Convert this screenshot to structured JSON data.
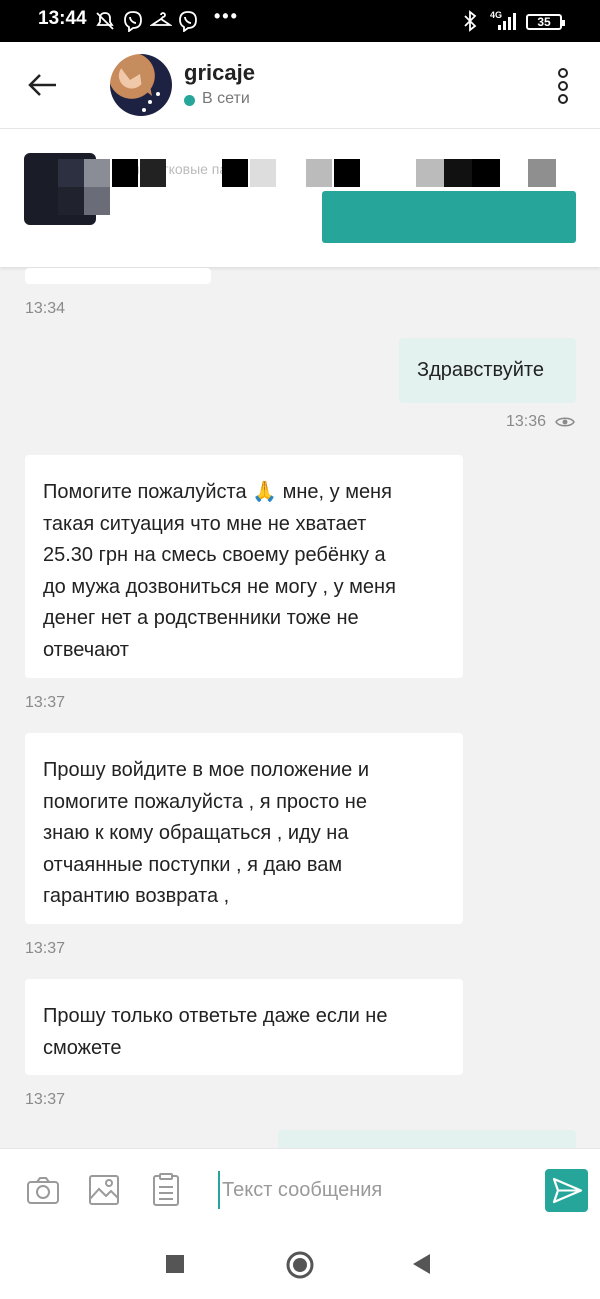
{
  "status_bar": {
    "time": "13:44",
    "battery": "35",
    "network": "4G",
    "overflow": "•••"
  },
  "header": {
    "contact_name": "gricaje",
    "status": "В сети"
  },
  "ad_banner": {
    "text_fragment": "простковые пак"
  },
  "messages": [
    {
      "time": "13:34",
      "direction": "incoming"
    },
    {
      "text": "Здравствуйте",
      "time": "13:36",
      "direction": "outgoing",
      "seen": true
    },
    {
      "lines": [
        "Помогите пожалуйста 🙏 мне, у меня",
        "такая ситуация что мне не хватает",
        "25.30 грн на смесь своему ребёнку а",
        "до мужа дозвониться не могу , у меня",
        "денег нет а родственники тоже не",
        "отвечают"
      ],
      "time": "13:37",
      "direction": "incoming"
    },
    {
      "lines": [
        "Прошу войдите в мое положение и",
        "помогите пожалуйста , я просто не",
        "знаю к кому обращаться , иду на",
        "отчаянные поступки , я даю вам",
        "гарантию возврата ,"
      ],
      "time": "13:37",
      "direction": "incoming"
    },
    {
      "lines": [
        "Прошу только ответьте даже если не",
        "сможете"
      ],
      "time": "13:37",
      "direction": "incoming"
    }
  ],
  "input": {
    "placeholder": "Текст сообщения",
    "value": ""
  },
  "colors": {
    "accent": "#26a69a",
    "outgoing_bubble": "#e3f1ef",
    "background": "#f2f2f2"
  }
}
